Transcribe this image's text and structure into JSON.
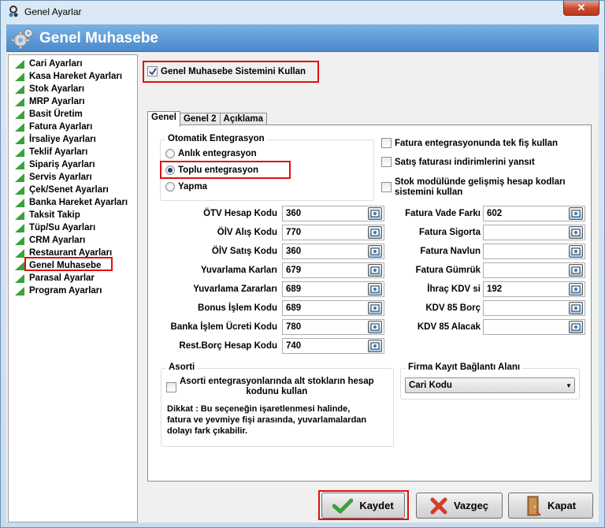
{
  "window": {
    "title": "Genel Ayarlar",
    "close_icon": "close-icon"
  },
  "header": {
    "title": "Genel Muhasebe",
    "icon": "gears-icon"
  },
  "sidebar": {
    "items": [
      {
        "label": "Cari Ayarları"
      },
      {
        "label": "Kasa Hareket Ayarları"
      },
      {
        "label": "Stok Ayarları"
      },
      {
        "label": "MRP Ayarları"
      },
      {
        "label": "Basit Üretim"
      },
      {
        "label": "Fatura Ayarları"
      },
      {
        "label": "İrsaliye Ayarları"
      },
      {
        "label": "Teklif Ayarları"
      },
      {
        "label": "Sipariş Ayarları"
      },
      {
        "label": "Servis Ayarları"
      },
      {
        "label": "Çek/Senet Ayarları"
      },
      {
        "label": "Banka Hareket Ayarları"
      },
      {
        "label": "Taksit Takip"
      },
      {
        "label": "Tüp/Su Ayarları"
      },
      {
        "label": "CRM Ayarları"
      },
      {
        "label": "Restaurant Ayarları"
      },
      {
        "label": "Genel Muhasebe"
      },
      {
        "label": "Parasal Ayarlar"
      },
      {
        "label": "Program Ayarları"
      }
    ],
    "selected": "Genel Muhasebe"
  },
  "main": {
    "use_system": {
      "label": "Genel Muhasebe Sistemini Kullan",
      "checked": true
    },
    "tabs": [
      {
        "label": "Genel"
      },
      {
        "label": "Genel 2"
      },
      {
        "label": "Açıklama"
      }
    ],
    "active_tab": "Genel",
    "integration": {
      "title": "Otomatik Entegrasyon",
      "options": [
        {
          "label": "Anlık entegrasyon"
        },
        {
          "label": "Toplu entegrasyon"
        },
        {
          "label": "Yapma"
        }
      ],
      "selected": "Toplu entegrasyon"
    },
    "right_checks": [
      {
        "label": "Fatura entegrasyonunda tek fiş kullan"
      },
      {
        "label": "Satış faturası indirimlerini yansıt"
      },
      {
        "label_line1": "Stok modülünde gelişmiş hesap kodları",
        "label_line2": "sistemini kullan"
      }
    ],
    "left_fields": [
      {
        "label": "ÖTV Hesap Kodu",
        "value": "360"
      },
      {
        "label": "ÖİV Alış Kodu",
        "value": "770"
      },
      {
        "label": "ÖİV Satış Kodu",
        "value": "360"
      },
      {
        "label": "Yuvarlama Karları",
        "value": "679"
      },
      {
        "label": "Yuvarlama Zararları",
        "value": "689"
      },
      {
        "label": "Bonus İşlem Kodu",
        "value": "689"
      },
      {
        "label": "Banka İşlem Ücreti Kodu",
        "value": "780"
      },
      {
        "label": "Rest.Borç Hesap Kodu",
        "value": "740"
      }
    ],
    "right_fields": [
      {
        "label": "Fatura Vade Farkı",
        "value": "602"
      },
      {
        "label": "Fatura Sigorta",
        "value": ""
      },
      {
        "label": "Fatura Navlun",
        "value": ""
      },
      {
        "label": "Fatura Gümrük",
        "value": ""
      },
      {
        "label": "İhraç KDV si",
        "value": "192"
      },
      {
        "label": "KDV 85 Borç",
        "value": ""
      },
      {
        "label": "KDV 85 Alacak",
        "value": ""
      }
    ],
    "asorti": {
      "title": "Asorti",
      "check_line1": "Asorti entegrasyonlarında alt stokların hesap",
      "check_line2": "kodunu kullan",
      "note_line1": "Dikkat : Bu seçeneğin işaretlenmesi halinde,",
      "note_line2": "fatura ve yevmiye fişi arasında, yuvarlamalardan",
      "note_line3": "dolayı fark çıkabilir."
    },
    "firma": {
      "title": "Firma Kayıt Bağlantı Alanı",
      "selected": "Cari Kodu"
    }
  },
  "buttons": {
    "save": "Kaydet",
    "cancel": "Vazgeç",
    "close": "Kapat"
  },
  "colors": {
    "header": "#4a89cc",
    "highlight": "#e01010",
    "accent_green": "#3aa23a"
  }
}
